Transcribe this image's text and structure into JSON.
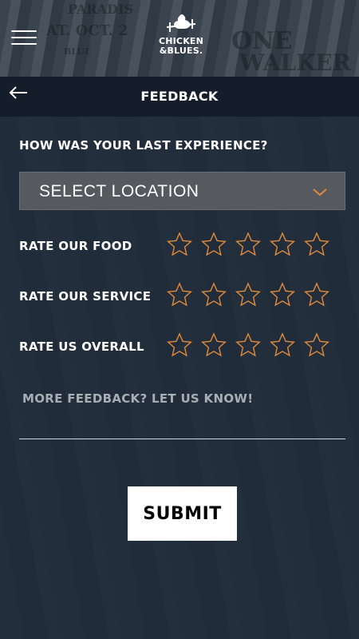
{
  "header": {
    "logo_line1": "CHICKEN",
    "logo_line2": "&BLUES.",
    "poster_texts": [
      "AT. OCT. 2",
      "ONE",
      "WALKER",
      "PARADIS",
      "BLUE"
    ]
  },
  "title_bar": {
    "title": "FEEDBACK"
  },
  "form": {
    "question": "HOW WAS YOUR LAST EXPERIENCE?",
    "location_select": {
      "selected": "SELECT LOCATION"
    },
    "ratings": [
      {
        "label": "RATE OUR FOOD",
        "value": 0,
        "max": 5
      },
      {
        "label": "RATE OUR SERVICE",
        "value": 0,
        "max": 5
      },
      {
        "label": "RATE US OVERALL",
        "value": 0,
        "max": 5
      }
    ],
    "feedback_placeholder": "MORE FEEDBACK? LET US KNOW!",
    "submit_label": "SUBMIT"
  },
  "colors": {
    "star_outline": "#e08a3c",
    "chevron": "#e08a3c",
    "background": "#1f2b39",
    "title_bar": "#141e2a"
  },
  "icons": {
    "menu": "hamburger-icon",
    "back": "arrow-left-icon",
    "dropdown": "chevron-down-icon",
    "rating": "star-outline-icon"
  }
}
